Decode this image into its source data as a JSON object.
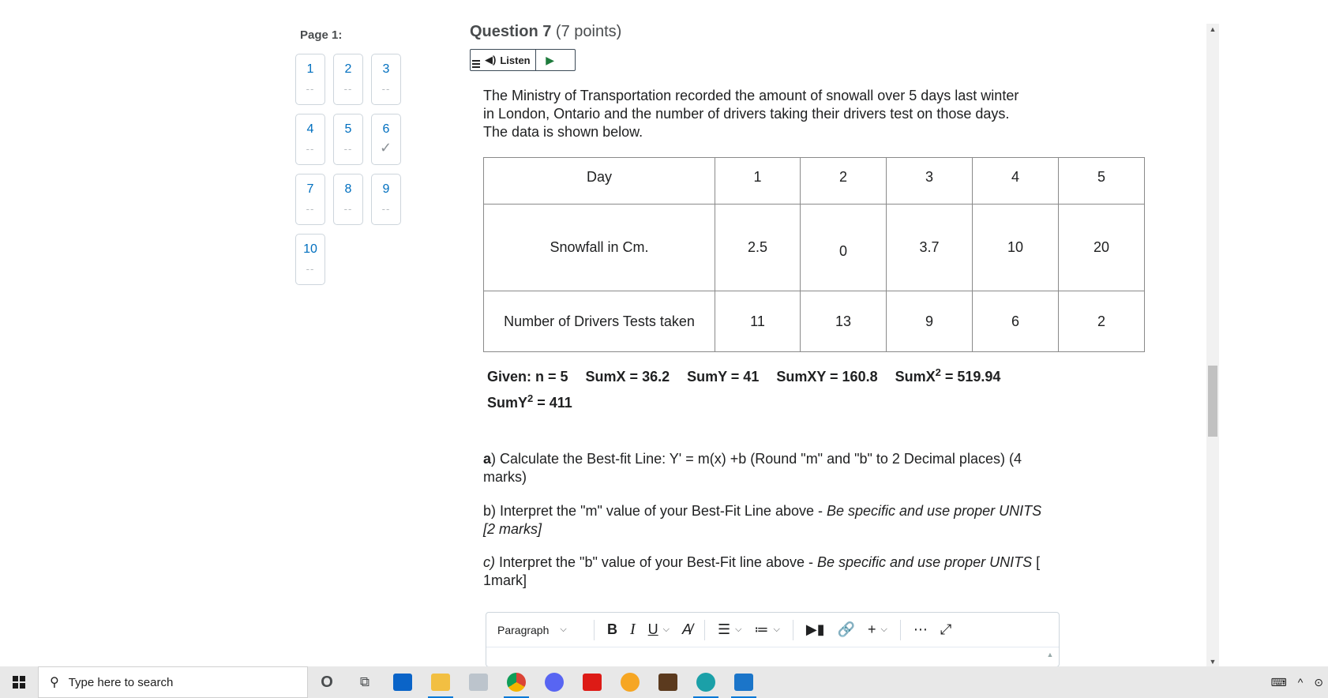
{
  "nav": {
    "page_label": "Page 1:",
    "questions": [
      {
        "num": "1",
        "status": "--"
      },
      {
        "num": "2",
        "status": "--"
      },
      {
        "num": "3",
        "status": "--"
      },
      {
        "num": "4",
        "status": "--"
      },
      {
        "num": "5",
        "status": "--"
      },
      {
        "num": "6",
        "status": "✓"
      },
      {
        "num": "7",
        "status": "--"
      },
      {
        "num": "8",
        "status": "--"
      },
      {
        "num": "9",
        "status": "--"
      },
      {
        "num": "10",
        "status": "--"
      }
    ]
  },
  "question": {
    "title": "Question 7",
    "points": "(7 points)",
    "listen_label": "Listen",
    "intro": "The Ministry of Transportation recorded the amount of snowall over 5 days last winter in London, Ontario and the number of drivers taking their drivers test on those days. The data is shown below.",
    "table": {
      "rows": [
        [
          "Day",
          "1",
          "2",
          "3",
          "4",
          "5"
        ],
        [
          "Snowfall in Cm.",
          "2.5",
          "0",
          "3.7",
          "10",
          "20"
        ],
        [
          "Number of Drivers Tests taken",
          "11",
          "13",
          "9",
          "6",
          "2"
        ]
      ]
    },
    "given": {
      "line1": [
        "Given: n = 5",
        "SumX = 36.2",
        "SumY = 41",
        "SumXY = 160.8"
      ],
      "sumx2_label": "SumX",
      "sumx2_value": " = 519.94",
      "sumy2_label": "SumY",
      "sumy2_value": " = 411",
      "sup": "2"
    },
    "part_a": {
      "letter": "a",
      "text": ") Calculate the Best-fit Line: Y' = m(x) +b  (Round \"m\" and \"b\" to 2 Decimal places)    (4 marks)"
    },
    "part_b": {
      "text": "b) Interpret the \"m\" value of your Best-Fit Line above - ",
      "italic": "Be specific and use proper UNITS   [2 marks]"
    },
    "part_c": {
      "italic_lead": "c)",
      "text": " Interpret the \"b\" value of your Best-Fit line above - ",
      "italic": "Be specific and use proper UNITS",
      "tail": "  [ 1mark]"
    }
  },
  "editor": {
    "format_label": "Paragraph"
  },
  "taskbar": {
    "search_placeholder": "Type here to search"
  },
  "colors": {
    "link_blue": "#006fbf",
    "text": "#202122",
    "accent": "#0078d7"
  }
}
